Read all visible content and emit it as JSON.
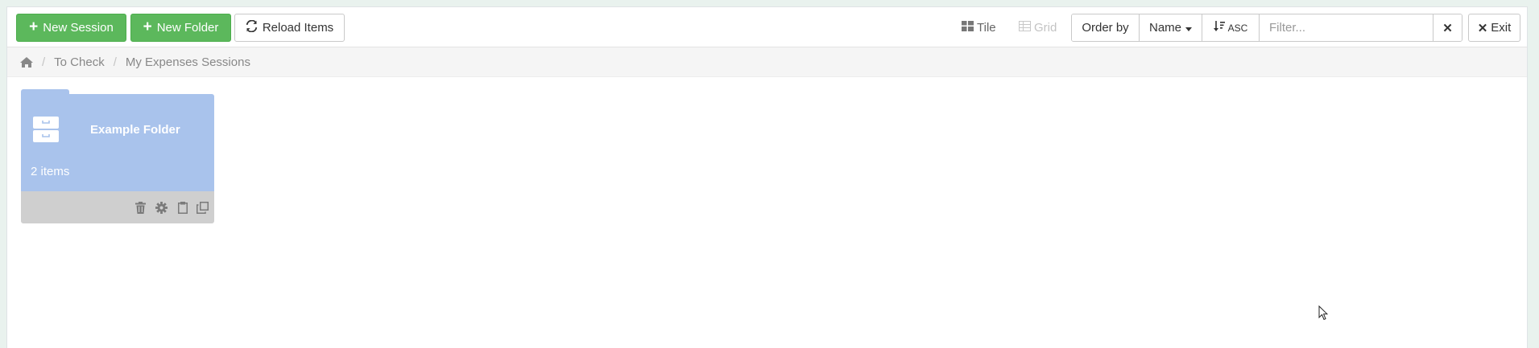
{
  "toolbar": {
    "new_session": "New Session",
    "new_folder": "New Folder",
    "reload_items": "Reload Items",
    "view_tile": "Tile",
    "view_grid": "Grid",
    "order_by_label": "Order by",
    "order_field": "Name",
    "sort_direction": "ASC",
    "filter_placeholder": "Filter...",
    "clear_filter": "✕",
    "exit": "Exit"
  },
  "breadcrumb": {
    "items": [
      "To Check",
      "My Expenses Sessions"
    ]
  },
  "folders": [
    {
      "name": "Example Folder",
      "count": "2 items"
    }
  ],
  "colors": {
    "primary_green": "#5cb85c",
    "folder_blue": "#a9c3ec",
    "folder_footer": "#cfcfcf",
    "page_border": "#e9f2ee"
  }
}
